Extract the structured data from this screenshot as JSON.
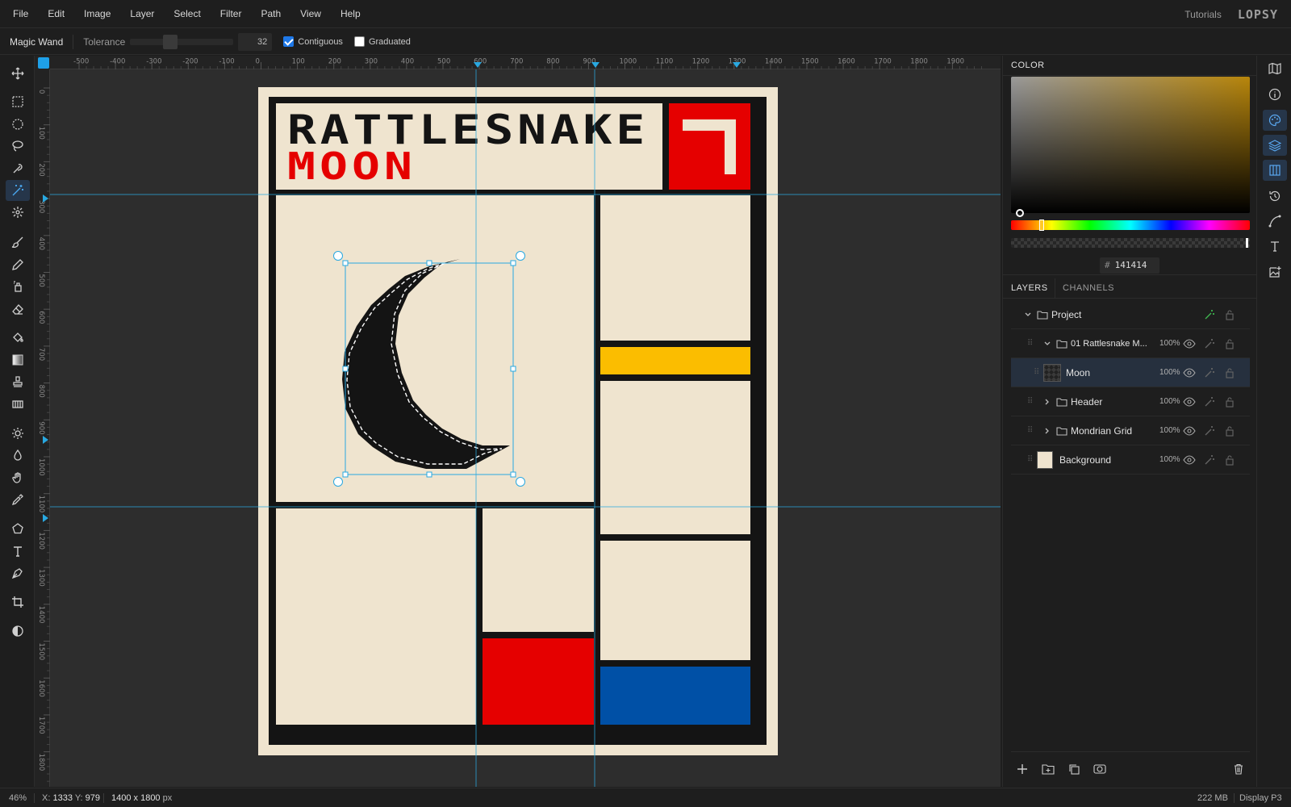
{
  "menu": [
    "File",
    "Edit",
    "Image",
    "Layer",
    "Select",
    "Filter",
    "Path",
    "View",
    "Help"
  ],
  "header": {
    "tutorials": "Tutorials",
    "logo": "LOPSY"
  },
  "options": {
    "tool_name": "Magic Wand",
    "tolerance_label": "Tolerance",
    "tolerance_value": "32",
    "tolerance_fraction": 0.32,
    "contiguous_label": "Contiguous",
    "contiguous_checked": true,
    "graduated_label": "Graduated",
    "graduated_checked": false
  },
  "tools": [
    "move-icon",
    "rect-select-icon",
    "ellipse-select-icon",
    "lasso-icon",
    "quick-select-icon",
    "magic-wand-icon",
    "spot-heal-icon",
    "brush-icon",
    "pencil-icon",
    "clone-icon",
    "eraser-icon",
    "bucket-icon",
    "gradient-icon",
    "stamp-icon",
    "pattern-icon",
    "dodge-icon",
    "drop-icon",
    "hand-icon",
    "eyedropper-icon",
    "shape-icon",
    "text-icon",
    "pen-icon",
    "crop-icon",
    "contrast-icon"
  ],
  "active_tool": "magic-wand-icon",
  "rulers": {
    "h_labels": [
      "-500",
      "-400",
      "-300",
      "-200",
      "-100",
      "0",
      "100",
      "200",
      "300",
      "400",
      "500",
      "600",
      "700",
      "800",
      "900",
      "1000",
      "1100",
      "1200",
      "1300",
      "1400",
      "1500",
      "1600",
      "1700",
      "1800",
      "1900"
    ],
    "v_labels": [
      "0",
      "100",
      "200",
      "300",
      "400",
      "500",
      "600",
      "700",
      "800",
      "900",
      "1000",
      "1100",
      "1200",
      "1300",
      "1400",
      "1500",
      "1600",
      "1700",
      "1800"
    ]
  },
  "artwork": {
    "title_line1": "RATTLESNAKE",
    "title_line2": "MOON",
    "colors": {
      "cream": "#efe4cf",
      "black": "#141414",
      "red": "#e50000",
      "yellow": "#fbbd00",
      "blue": "#0050a6",
      "guide": "#29a8e0"
    }
  },
  "color_panel": {
    "tab": "COLOR",
    "hex": "141414"
  },
  "layers_panel": {
    "tabs": [
      "LAYERS",
      "CHANNELS"
    ],
    "layers": [
      {
        "name": "Project",
        "opacity": ""
      },
      {
        "name": "01 Rattlesnake M...",
        "opacity": "100%"
      },
      {
        "name": "Moon",
        "opacity": "100%"
      },
      {
        "name": "Header",
        "opacity": "100%"
      },
      {
        "name": "Mondrian Grid",
        "opacity": "100%"
      },
      {
        "name": "Background",
        "opacity": "100%"
      }
    ]
  },
  "status": {
    "zoom": "46%",
    "x_label": "X:",
    "x": "1333",
    "y_label": "Y:",
    "y": "979",
    "doc_size": "1400 x 1800",
    "doc_unit": "px",
    "memory": "222 MB",
    "color_profile": "Display P3"
  }
}
